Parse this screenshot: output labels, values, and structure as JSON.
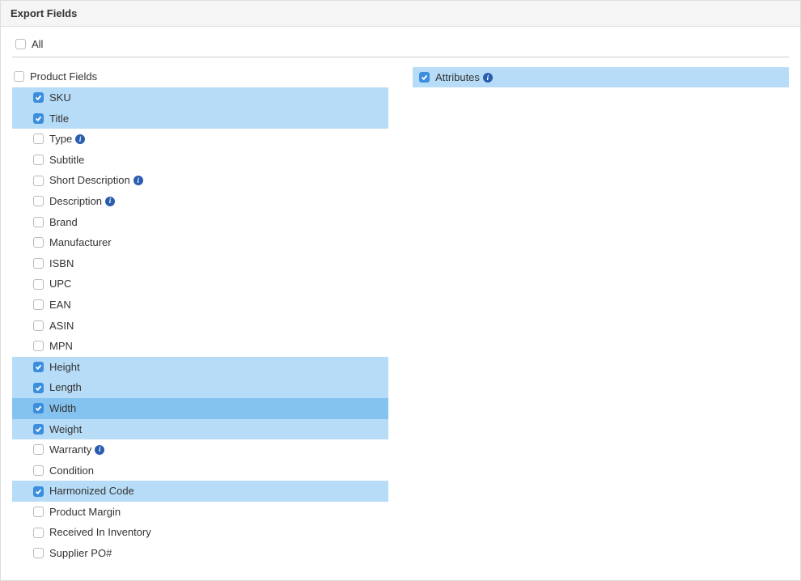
{
  "panel": {
    "title": "Export Fields"
  },
  "all": {
    "label": "All",
    "checked": false
  },
  "left": {
    "group_label": "Product Fields",
    "group_checked": false,
    "items": [
      {
        "label": "SKU",
        "checked": true,
        "info": false,
        "dark": false
      },
      {
        "label": "Title",
        "checked": true,
        "info": false,
        "dark": false
      },
      {
        "label": "Type",
        "checked": false,
        "info": true,
        "dark": false
      },
      {
        "label": "Subtitle",
        "checked": false,
        "info": false,
        "dark": false
      },
      {
        "label": "Short Description",
        "checked": false,
        "info": true,
        "dark": false
      },
      {
        "label": "Description",
        "checked": false,
        "info": true,
        "dark": false
      },
      {
        "label": "Brand",
        "checked": false,
        "info": false,
        "dark": false
      },
      {
        "label": "Manufacturer",
        "checked": false,
        "info": false,
        "dark": false
      },
      {
        "label": "ISBN",
        "checked": false,
        "info": false,
        "dark": false
      },
      {
        "label": "UPC",
        "checked": false,
        "info": false,
        "dark": false
      },
      {
        "label": "EAN",
        "checked": false,
        "info": false,
        "dark": false
      },
      {
        "label": "ASIN",
        "checked": false,
        "info": false,
        "dark": false
      },
      {
        "label": "MPN",
        "checked": false,
        "info": false,
        "dark": false
      },
      {
        "label": "Height",
        "checked": true,
        "info": false,
        "dark": false
      },
      {
        "label": "Length",
        "checked": true,
        "info": false,
        "dark": false
      },
      {
        "label": "Width",
        "checked": true,
        "info": false,
        "dark": true
      },
      {
        "label": "Weight",
        "checked": true,
        "info": false,
        "dark": false
      },
      {
        "label": "Warranty",
        "checked": false,
        "info": true,
        "dark": false
      },
      {
        "label": "Condition",
        "checked": false,
        "info": false,
        "dark": false
      },
      {
        "label": "Harmonized Code",
        "checked": true,
        "info": false,
        "dark": false
      },
      {
        "label": "Product Margin",
        "checked": false,
        "info": false,
        "dark": false
      },
      {
        "label": "Received In Inventory",
        "checked": false,
        "info": false,
        "dark": false
      },
      {
        "label": "Supplier PO#",
        "checked": false,
        "info": false,
        "dark": false
      }
    ]
  },
  "right": {
    "label": "Attributes",
    "checked": true,
    "info": true
  }
}
